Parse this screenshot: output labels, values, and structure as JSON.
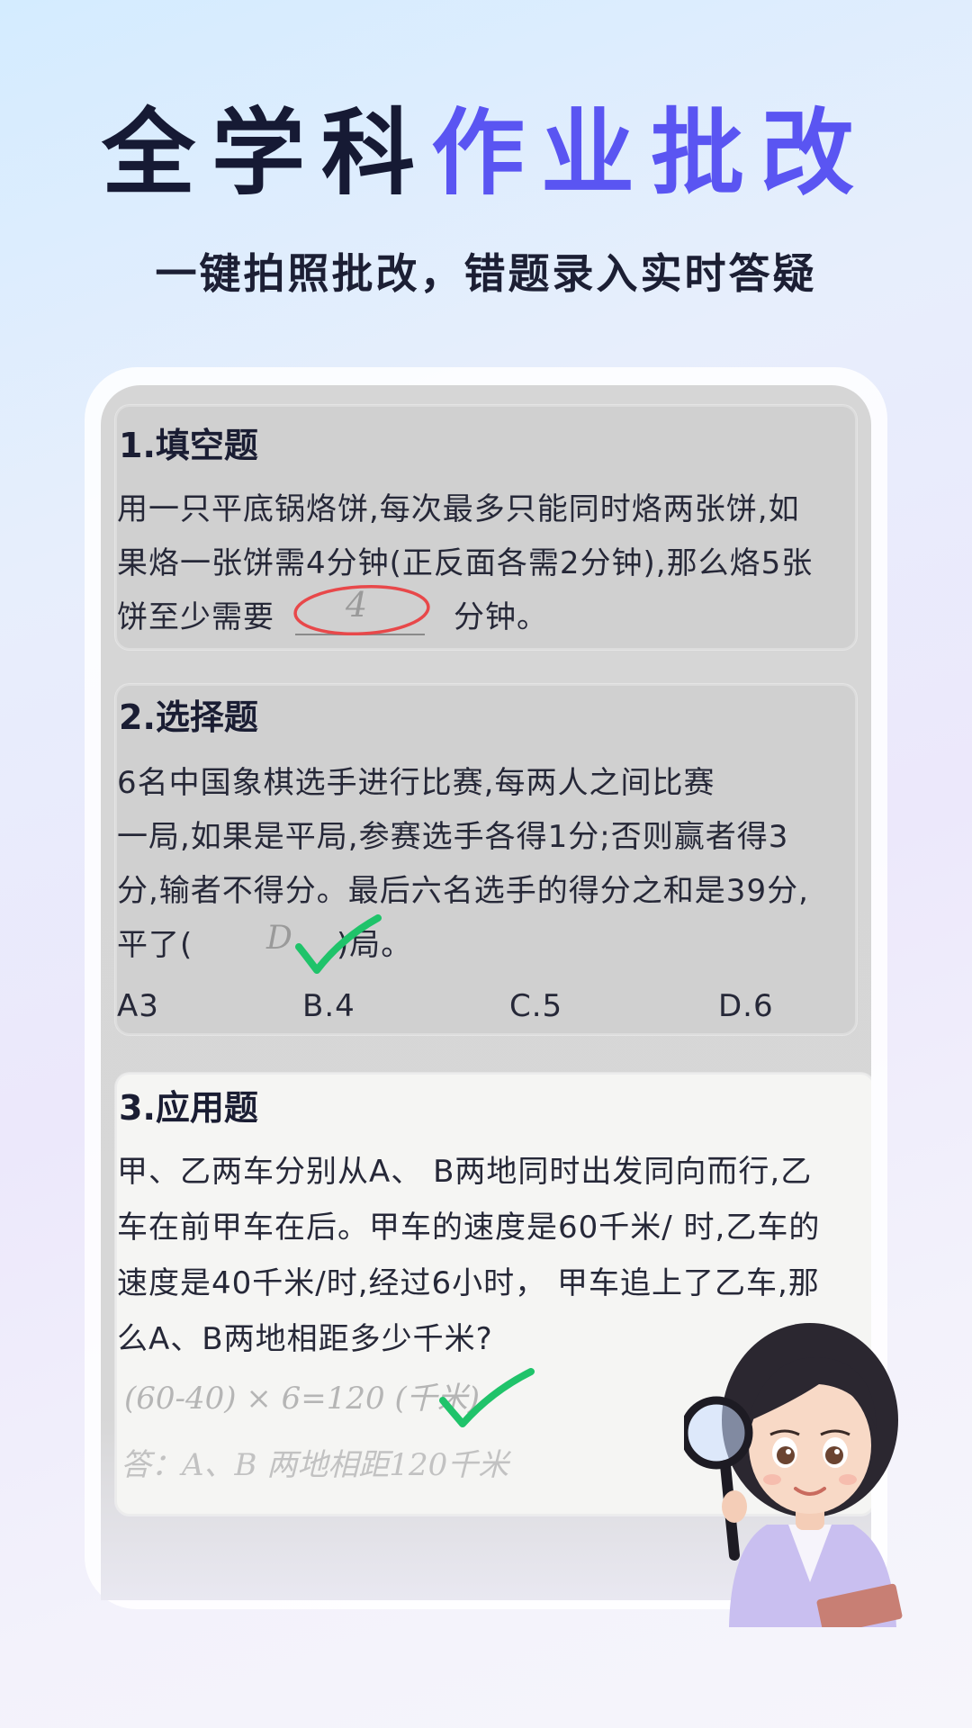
{
  "header": {
    "title_part1": "全学科",
    "title_part2": "作业批改",
    "subtitle": "一键拍照批改，错题录入实时答疑"
  },
  "questions": [
    {
      "title": "1.填空题",
      "lines": [
        "用一只平底锅烙饼,每次最多只能同时烙两张饼,如",
        "果烙一张饼需4分钟(正反面各需2分钟),那么烙5张",
        "饼至少需要"
      ],
      "tail": "分钟。",
      "handwritten_answer": "4"
    },
    {
      "title": "2.选择题",
      "lines": [
        "6名中国象棋选手进行比赛,每两人之间比赛",
        "一局,如果是平局,参赛选手各得1分;否则赢者得3",
        "分,输者不得分。最后六名选手的得分之和是39分,"
      ],
      "blank_prefix": "平了(",
      "blank_suffix": ")局。",
      "handwritten_answer": "D",
      "options": [
        "A3",
        "B.4",
        "C.5",
        "D.6"
      ]
    },
    {
      "title": "3.应用题",
      "lines": [
        "甲、乙两车分别从A、 B两地同时出发同向而行,乙",
        "车在前甲车在后。甲车的速度是60千米/ 时,乙车的",
        "速度是40千米/时,经过6小时， 甲车追上了乙车,那",
        "么A、B两地相距多少千米?"
      ],
      "handwritten_work": "(60-40) × 6=120 (千米)",
      "handwritten_answer": "答：A、B 两地相距120千米"
    }
  ],
  "colors": {
    "title_dark": "#161a34",
    "title_accent": "#5a55f2",
    "check_green": "#1fc36a",
    "wrong_circle_red": "#e8484a"
  },
  "icons": [
    "check-mark-icon",
    "wrong-circle-icon",
    "magnifier-icon"
  ]
}
